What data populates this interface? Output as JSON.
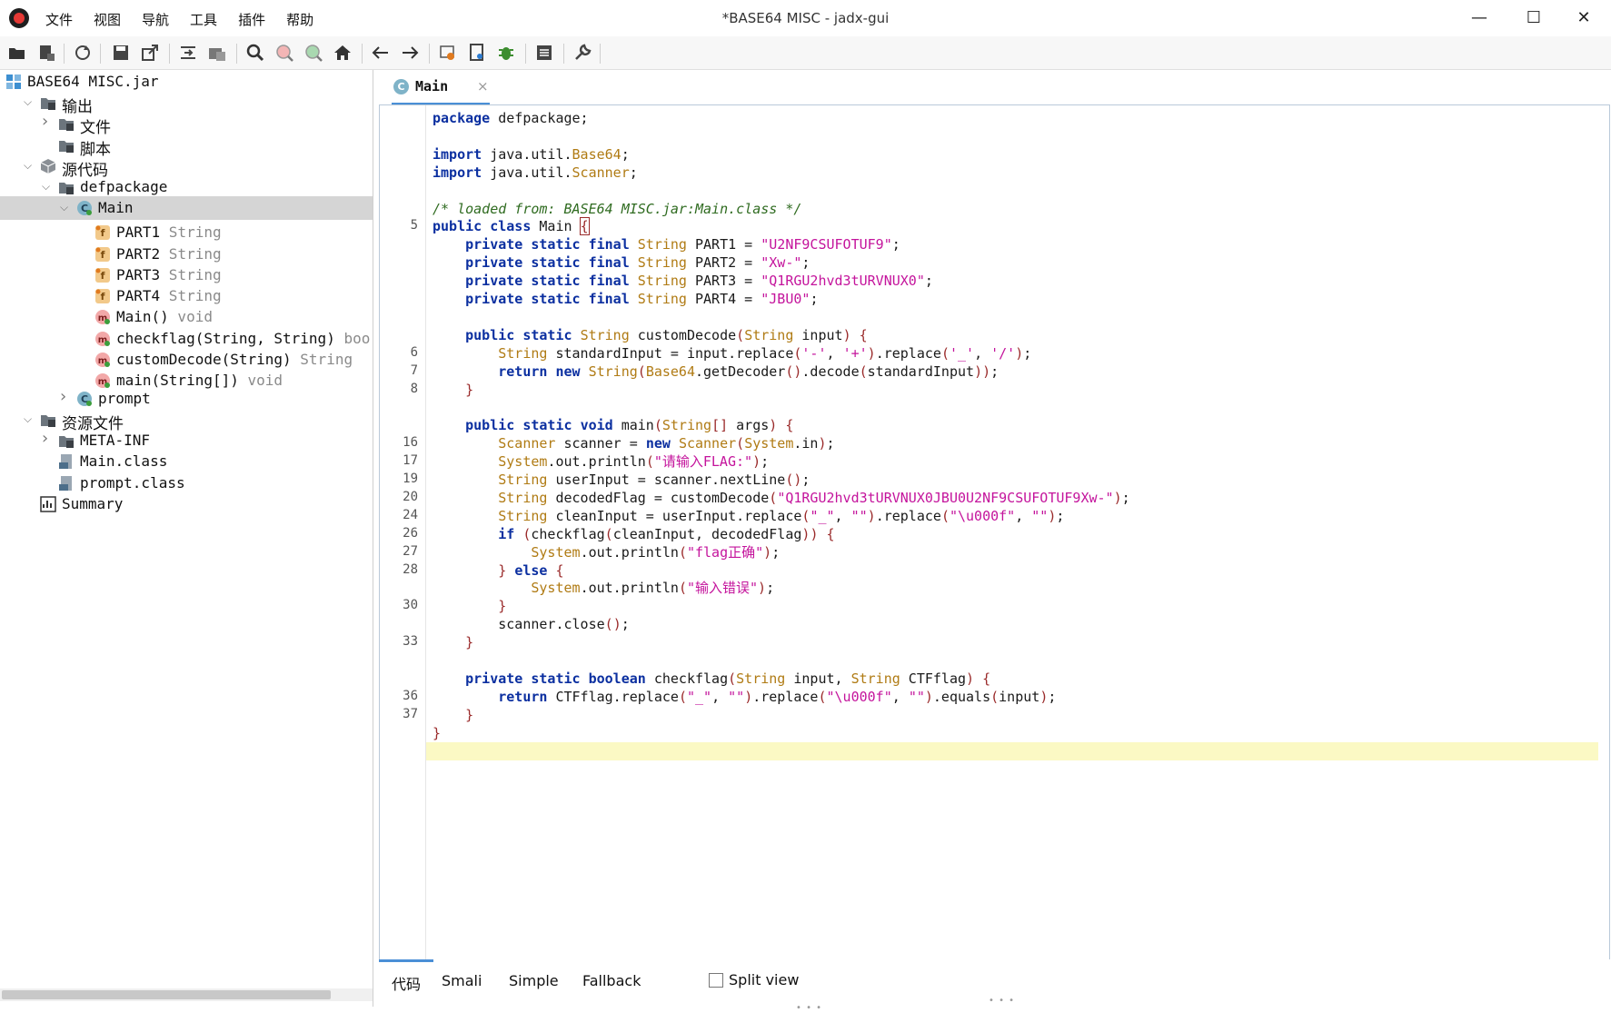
{
  "window": {
    "title": "*BASE64 MISC - jadx-gui",
    "menu": [
      "文件",
      "视图",
      "导航",
      "工具",
      "插件",
      "帮助"
    ],
    "controls": {
      "minimize": "—",
      "maximize": "☐",
      "close": "✕"
    }
  },
  "toolbar": {
    "icons": [
      "open-icon",
      "add-files-icon",
      "reload-icon",
      "save-icon",
      "export-icon",
      "sync-tree-icon",
      "flatten-icon",
      "search-icon",
      "find-usage-icon",
      "find-class-icon",
      "home-icon",
      "back-icon",
      "forward-icon",
      "deobfuscate-icon",
      "log-icon",
      "debug-icon",
      "plugins-icon",
      "settings-icon"
    ]
  },
  "tree": {
    "items": [
      {
        "label": "BASE64 MISC.jar",
        "type": "",
        "icon": "jar-icon",
        "indent": 0,
        "arrow": ""
      },
      {
        "label": "输出",
        "type": "",
        "icon": "folder-icon",
        "indent": 1,
        "arrow": "v"
      },
      {
        "label": "文件",
        "type": "",
        "icon": "folder-icon",
        "indent": 2,
        "arrow": ">"
      },
      {
        "label": "脚本",
        "type": "",
        "icon": "folder-icon",
        "indent": 2,
        "arrow": ""
      },
      {
        "label": "源代码",
        "type": "",
        "icon": "package-icon",
        "indent": 1,
        "arrow": "v"
      },
      {
        "label": "defpackage",
        "type": "",
        "icon": "folder-icon",
        "indent": 2,
        "arrow": "v"
      },
      {
        "label": "Main",
        "type": "",
        "icon": "class-icon",
        "indent": 3,
        "arrow": "v"
      },
      {
        "label": "PART1",
        "type": "String",
        "icon": "field-icon",
        "indent": 4,
        "arrow": ""
      },
      {
        "label": "PART2",
        "type": "String",
        "icon": "field-icon",
        "indent": 4,
        "arrow": ""
      },
      {
        "label": "PART3",
        "type": "String",
        "icon": "field-icon",
        "indent": 4,
        "arrow": ""
      },
      {
        "label": "PART4",
        "type": "String",
        "icon": "field-icon",
        "indent": 4,
        "arrow": ""
      },
      {
        "label": "Main()",
        "type": "void",
        "icon": "method-icon",
        "indent": 4,
        "arrow": ""
      },
      {
        "label": "checkflag(String, String)",
        "type": "boo",
        "icon": "method-icon",
        "indent": 4,
        "arrow": ""
      },
      {
        "label": "customDecode(String)",
        "type": "String",
        "icon": "method-icon",
        "indent": 4,
        "arrow": ""
      },
      {
        "label": "main(String[])",
        "type": "void",
        "icon": "method-icon",
        "indent": 4,
        "arrow": ""
      },
      {
        "label": "prompt",
        "type": "",
        "icon": "class-icon",
        "indent": 3,
        "arrow": ">"
      },
      {
        "label": "资源文件",
        "type": "",
        "icon": "folder-icon",
        "indent": 1,
        "arrow": "v"
      },
      {
        "label": "META-INF",
        "type": "",
        "icon": "folder-icon",
        "indent": 2,
        "arrow": ">"
      },
      {
        "label": "Main.class",
        "type": "",
        "icon": "file-icon",
        "indent": 2,
        "arrow": ""
      },
      {
        "label": "prompt.class",
        "type": "",
        "icon": "file-icon",
        "indent": 2,
        "arrow": ""
      },
      {
        "label": "Summary",
        "type": "",
        "icon": "summary-icon",
        "indent": 1,
        "arrow": ""
      }
    ],
    "selected": "Main"
  },
  "editor": {
    "tab_label": "Main",
    "tab_close": "×",
    "tab_icon_letter": "C",
    "line_numbers": [
      {
        "row": 6,
        "num": "5"
      },
      {
        "row": 13,
        "num": "6"
      },
      {
        "row": 14,
        "num": "7"
      },
      {
        "row": 15,
        "num": "8"
      },
      {
        "row": 18,
        "num": "16"
      },
      {
        "row": 19,
        "num": "17"
      },
      {
        "row": 20,
        "num": "19"
      },
      {
        "row": 21,
        "num": "20"
      },
      {
        "row": 22,
        "num": "24"
      },
      {
        "row": 23,
        "num": "26"
      },
      {
        "row": 24,
        "num": "27"
      },
      {
        "row": 25,
        "num": "28"
      },
      {
        "row": 27,
        "num": "30"
      },
      {
        "row": 29,
        "num": "33"
      },
      {
        "row": 32,
        "num": "36"
      },
      {
        "row": 33,
        "num": "37"
      }
    ],
    "code": [
      "package defpackage;",
      "",
      "import java.util.Base64;",
      "import java.util.Scanner;",
      "",
      "/* loaded from: BASE64 MISC.jar:Main.class */",
      "public class Main {",
      "    private static final String PART1 = \"U2NF9CSUFOTUF9\";",
      "    private static final String PART2 = \"Xw-\";",
      "    private static final String PART3 = \"Q1RGU2hvd3tURVNUX0\";",
      "    private static final String PART4 = \"JBU0\";",
      "",
      "    public static String customDecode(String input) {",
      "        String standardInput = input.replace('-', '+').replace('_', '/');",
      "        return new String(Base64.getDecoder().decode(standardInput));",
      "    }",
      "",
      "    public static void main(String[] args) {",
      "        Scanner scanner = new Scanner(System.in);",
      "        System.out.println(\"请输入FLAG:\");",
      "        String userInput = scanner.nextLine();",
      "        String decodedFlag = customDecode(\"Q1RGU2hvd3tURVNUX0JBU0U2NF9CSUFOTUF9Xw-\");",
      "        String cleanInput = userInput.replace(\"_\", \"\").replace(\"\\u000f\", \"\");",
      "        if (checkflag(cleanInput, decodedFlag)) {",
      "            System.out.println(\"flag正确\");",
      "        } else {",
      "            System.out.println(\"输入错误\");",
      "        }",
      "        scanner.close();",
      "    }",
      "",
      "    private static boolean checkflag(String input, String CTFflag) {",
      "        return CTFflag.replace(\"_\", \"\").replace(\"\\u000f\", \"\").equals(input);",
      "    }",
      "}"
    ],
    "current_line": 35
  },
  "bottom_tabs": {
    "tabs": [
      "代码",
      "Smali",
      "Simple",
      "Fallback"
    ],
    "active": "代码",
    "split_view_label": "Split view",
    "split_view_checked": false
  }
}
